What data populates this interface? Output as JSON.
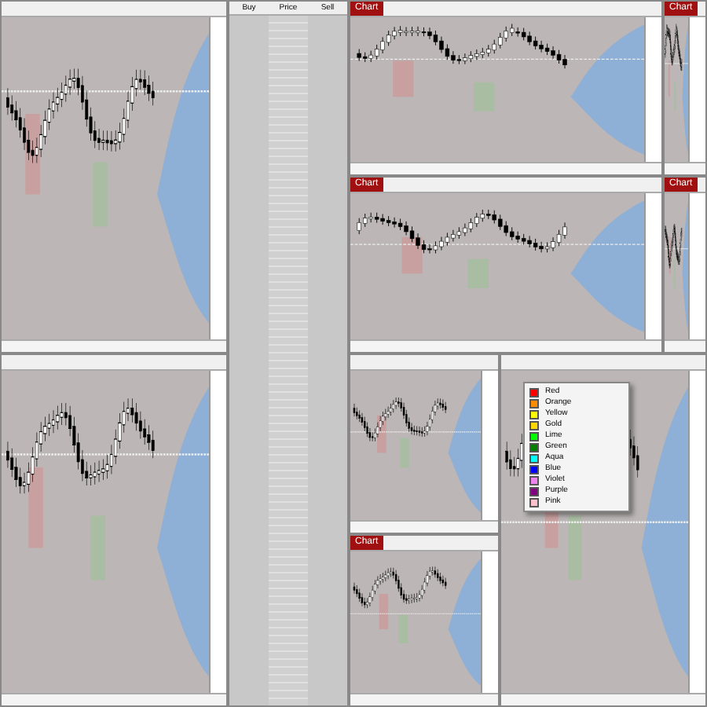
{
  "panels": [
    {
      "kind": "chart"
    },
    {
      "kind": "chart"
    },
    {
      "kind": "chart",
      "title": "Chart"
    },
    {
      "kind": "chart",
      "title": "Chart"
    },
    {
      "kind": "chart",
      "title": "Chart"
    },
    {
      "kind": "chart",
      "title": "Chart"
    },
    {
      "kind": "chart"
    },
    {
      "kind": "chart",
      "title": "Chart"
    },
    {
      "kind": "chart"
    }
  ],
  "ladder": {
    "columns": [
      "Buy",
      "Price",
      "Sell"
    ]
  },
  "color_menu": {
    "items": [
      {
        "label": "Red",
        "color": "#ff0000"
      },
      {
        "label": "Orange",
        "color": "#ff8c00"
      },
      {
        "label": "Yellow",
        "color": "#ffff00"
      },
      {
        "label": "Gold",
        "color": "#ffd700"
      },
      {
        "label": "Lime",
        "color": "#00ff00"
      },
      {
        "label": "Green",
        "color": "#008000"
      },
      {
        "label": "Aqua",
        "color": "#00ffff"
      },
      {
        "label": "Blue",
        "color": "#0000ff"
      },
      {
        "label": "Violet",
        "color": "#ee82ee"
      },
      {
        "label": "Purple",
        "color": "#800080"
      },
      {
        "label": "Pink",
        "color": "#ffc0cb"
      }
    ]
  }
}
